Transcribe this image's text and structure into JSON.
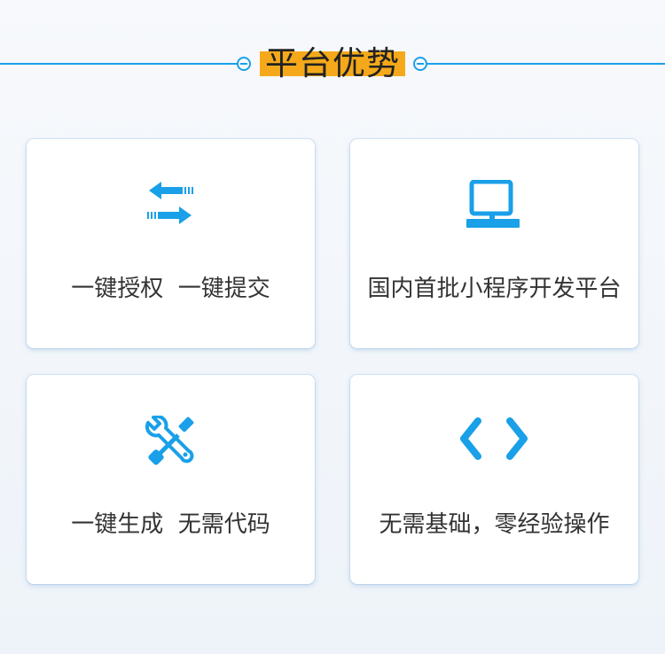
{
  "section": {
    "title": "平台优势"
  },
  "colors": {
    "accent": "#1aa0e8",
    "highlight": "#f5a91a"
  },
  "cards": [
    {
      "icon": "swap-arrows-icon",
      "label": "一键授权  一键提交"
    },
    {
      "icon": "computer-monitor-icon",
      "label": "国内首批小程序开发平台"
    },
    {
      "icon": "wrench-screwdriver-icon",
      "label": "一键生成  无需代码"
    },
    {
      "icon": "code-brackets-icon",
      "label": "无需基础，零经验操作"
    }
  ]
}
